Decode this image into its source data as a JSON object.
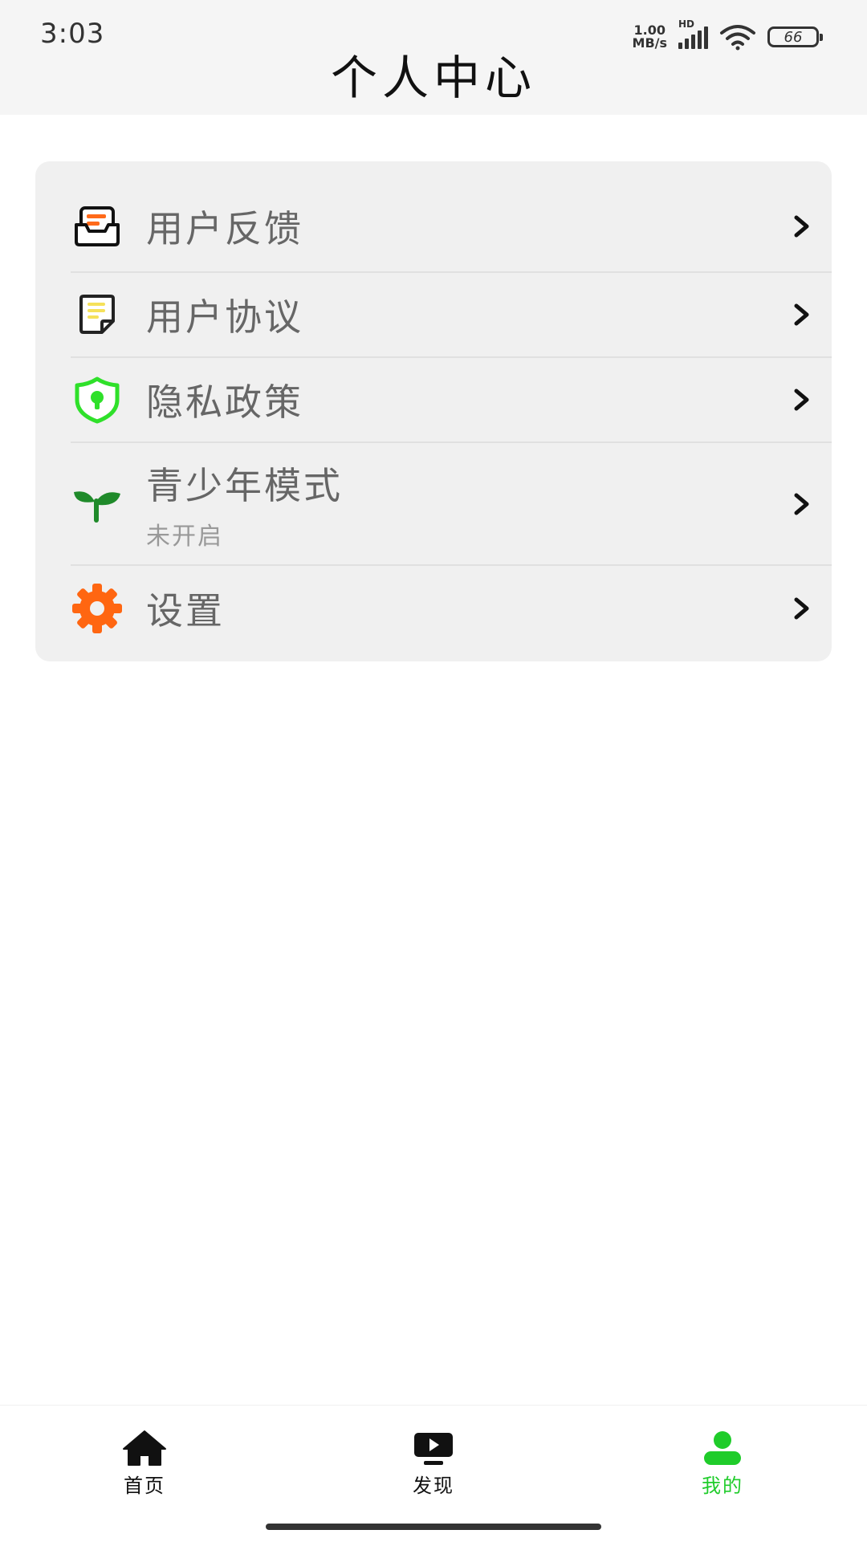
{
  "status_bar": {
    "time": "3:03",
    "net_speed_value": "1.00",
    "net_speed_unit": "MB/s",
    "hd": "HD",
    "battery": "66"
  },
  "header": {
    "title": "个人中心"
  },
  "menu": {
    "items": [
      {
        "label": "用户反馈",
        "icon": "feedback-tray-icon"
      },
      {
        "label": "用户协议",
        "icon": "document-note-icon"
      },
      {
        "label": "隐私政策",
        "icon": "shield-lock-icon"
      },
      {
        "label": "青少年模式",
        "sub": "未开启",
        "icon": "sprout-icon"
      },
      {
        "label": "设置",
        "icon": "gear-icon"
      }
    ]
  },
  "tabbar": {
    "tabs": [
      {
        "label": "首页",
        "icon": "home-icon"
      },
      {
        "label": "发现",
        "icon": "play-screen-icon"
      },
      {
        "label": "我的",
        "icon": "person-icon",
        "active": true
      }
    ],
    "active_color": "#1fcc2a"
  },
  "colors": {
    "feedback_accent": "#ff6a1a",
    "note_accent": "#f5e15a",
    "shield_green": "#2fe02a",
    "sprout_green": "#1f8a2a",
    "gear_orange": "#ff6611"
  }
}
